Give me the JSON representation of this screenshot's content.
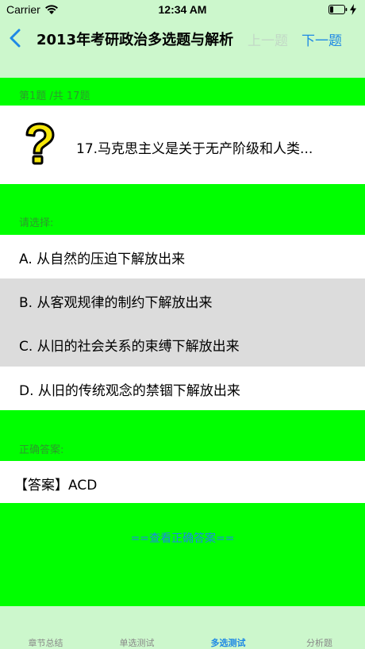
{
  "status_bar": {
    "carrier": "Carrier",
    "time": "12:34 AM"
  },
  "nav": {
    "title": "2013年考研政治多选题与解析",
    "prev_label": "上一题",
    "next_label": "下一题"
  },
  "question": {
    "counter": "第1题 /共 17题",
    "text": "17.马克思主义是关于无产阶级和人类...",
    "choose_label": "请选择:"
  },
  "options": [
    {
      "label": "A.  从自然的压迫下解放出来",
      "selected": false
    },
    {
      "label": "B.  从客观规律的制约下解放出来",
      "selected": true
    },
    {
      "label": "C.  从旧的社会关系的束缚下解放出来",
      "selected": true
    },
    {
      "label": "D.  从旧的传统观念的禁锢下解放出来",
      "selected": false
    }
  ],
  "answer": {
    "label": "正确答案:",
    "text": "【答案】ACD",
    "view_button": "==查看正确答案=="
  },
  "tabs": [
    {
      "label": "章节总结",
      "active": false
    },
    {
      "label": "单选测试",
      "active": false
    },
    {
      "label": "多选测试",
      "active": true
    },
    {
      "label": "分析题",
      "active": false
    }
  ],
  "colors": {
    "page_background": "#00ff00",
    "bar_background": "#ccf7cc",
    "accent": "#1e88e5",
    "selected_option": "#dcdcdc"
  }
}
